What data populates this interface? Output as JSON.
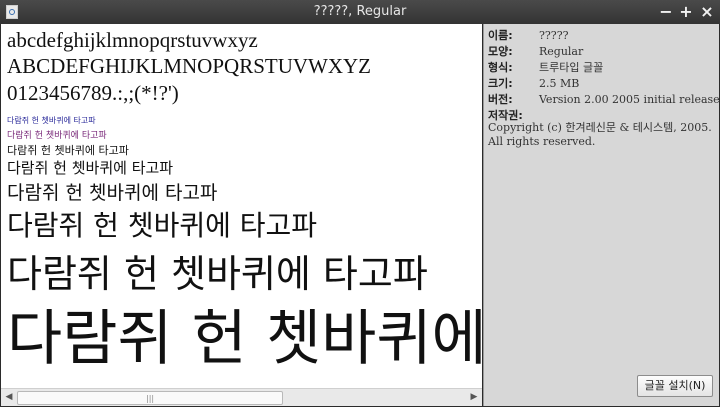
{
  "window": {
    "title": "?????, Regular",
    "minimize_icon": "minimize-icon",
    "maximize_icon": "maximize-icon",
    "close_icon": "close-icon",
    "min_glyph": "−",
    "max_glyph": "+",
    "close_glyph": "×"
  },
  "preview": {
    "lowercase": "abcdefghijklmnopqrstuvwxyz",
    "uppercase": "ABCDEFGHIJKLMNOPQRSTUVWXYZ",
    "digits": "0123456789.:,;(*!?')",
    "samples": [
      "다람쥐 헌 쳇바퀴에 타고파",
      "다람쥐 헌 쳇바퀴에 타고파",
      "다람쥐 헌 쳇바퀴에 타고파",
      "다람쥐 헌 쳇바퀴에 타고파",
      "다람쥐 헌 쳇바퀴에 타고파",
      "다람쥐 헌 쳇바퀴에 타고파",
      "다람쥐 헌 쳇바퀴에 타고파",
      "다람쥐 헌 쳇바퀴에 타고파"
    ]
  },
  "info": {
    "rows": [
      {
        "label": "이름:",
        "value": "?????"
      },
      {
        "label": "모양:",
        "value": "Regular"
      },
      {
        "label": "형식:",
        "value": "트루타입 글꼴"
      },
      {
        "label": "크기:",
        "value": "2.5 MB"
      },
      {
        "label": "버전:",
        "value": "Version 2.00 2005 initial release"
      },
      {
        "label": "저작권:",
        "value": ""
      }
    ],
    "copyright": "Copyright (c) 한겨레신문 & 테시스템, 2005. All rights reserved."
  },
  "install_button": "글꼴 설치(N)",
  "scrollbar": {
    "left_arrow": "◀",
    "right_arrow": "▶",
    "grip": "|||"
  }
}
